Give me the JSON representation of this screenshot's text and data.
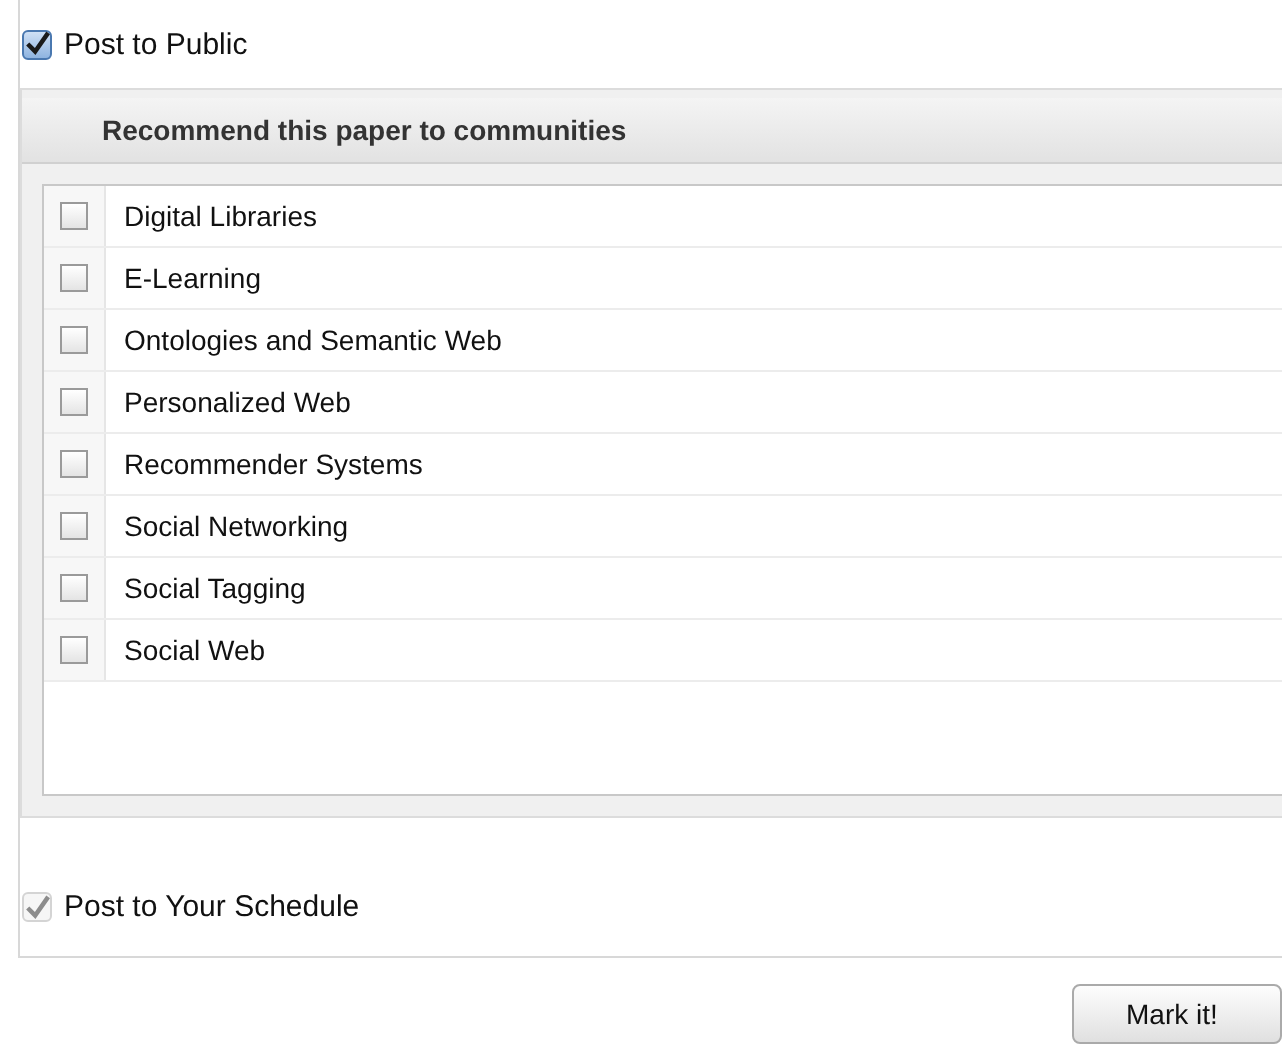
{
  "post_public": {
    "label": "Post to Public",
    "checked": true,
    "disabled": false
  },
  "communities": {
    "title": "Recommend this paper to communities",
    "items": [
      {
        "label": "Digital Libraries",
        "checked": false
      },
      {
        "label": "E-Learning",
        "checked": false
      },
      {
        "label": "Ontologies and Semantic Web",
        "checked": false
      },
      {
        "label": "Personalized Web",
        "checked": false
      },
      {
        "label": "Recommender Systems",
        "checked": false
      },
      {
        "label": "Social Networking",
        "checked": false
      },
      {
        "label": "Social Tagging",
        "checked": false
      },
      {
        "label": "Social Web",
        "checked": false
      }
    ]
  },
  "post_schedule": {
    "label": "Post to Your Schedule",
    "checked": true,
    "disabled": true
  },
  "submit": {
    "label": "Mark it!"
  }
}
